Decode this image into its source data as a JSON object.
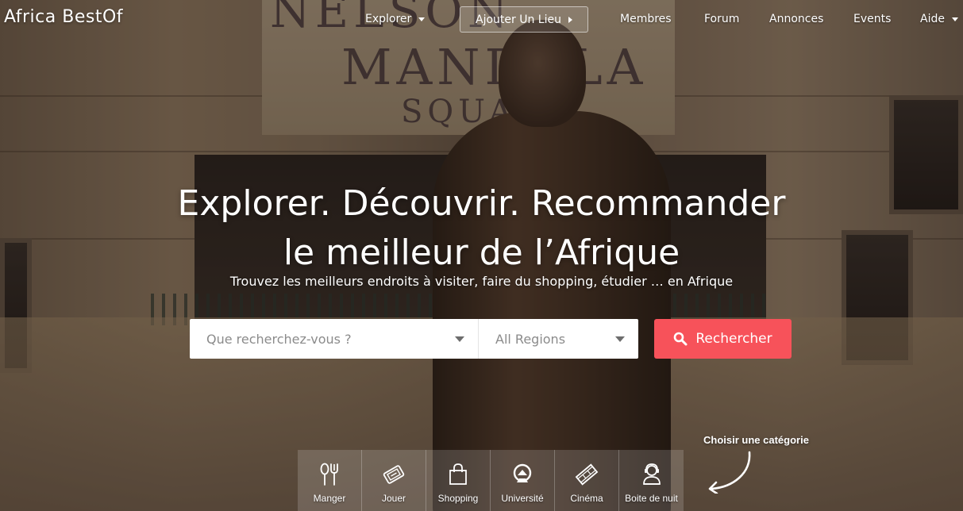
{
  "brand": "Africa BestOf",
  "nav": {
    "explorer": "Explorer",
    "add_place": "Ajouter Un Lieu",
    "members": "Membres",
    "forum": "Forum",
    "listings": "Annonces",
    "events": "Events",
    "help": "Aide"
  },
  "hero": {
    "title_line1": "Explorer. Découvrir. Recommander",
    "title_line2": "le meilleur de l’Afrique",
    "subtitle": "Trouvez les meilleurs endroits à visiter, faire du shopping, étudier … en Afrique"
  },
  "search": {
    "query_placeholder": "Que recherchez-vous ?",
    "region_value": "All Regions",
    "button_label": "Rechercher"
  },
  "categories": {
    "hint": "Choisir une catégorie",
    "items": [
      {
        "label": "Manger",
        "icon": "fork-spoon-icon"
      },
      {
        "label": "Jouer",
        "icon": "ticket-icon"
      },
      {
        "label": "Shopping",
        "icon": "shopping-bag-icon"
      },
      {
        "label": "Université",
        "icon": "university-icon"
      },
      {
        "label": "Cinéma",
        "icon": "film-strip-icon"
      },
      {
        "label": "Boite de nuit",
        "icon": "nightclub-icon"
      }
    ]
  },
  "colors": {
    "accent": "#f7525a",
    "search_bg": "#ffffff",
    "text": "#ffffff"
  }
}
